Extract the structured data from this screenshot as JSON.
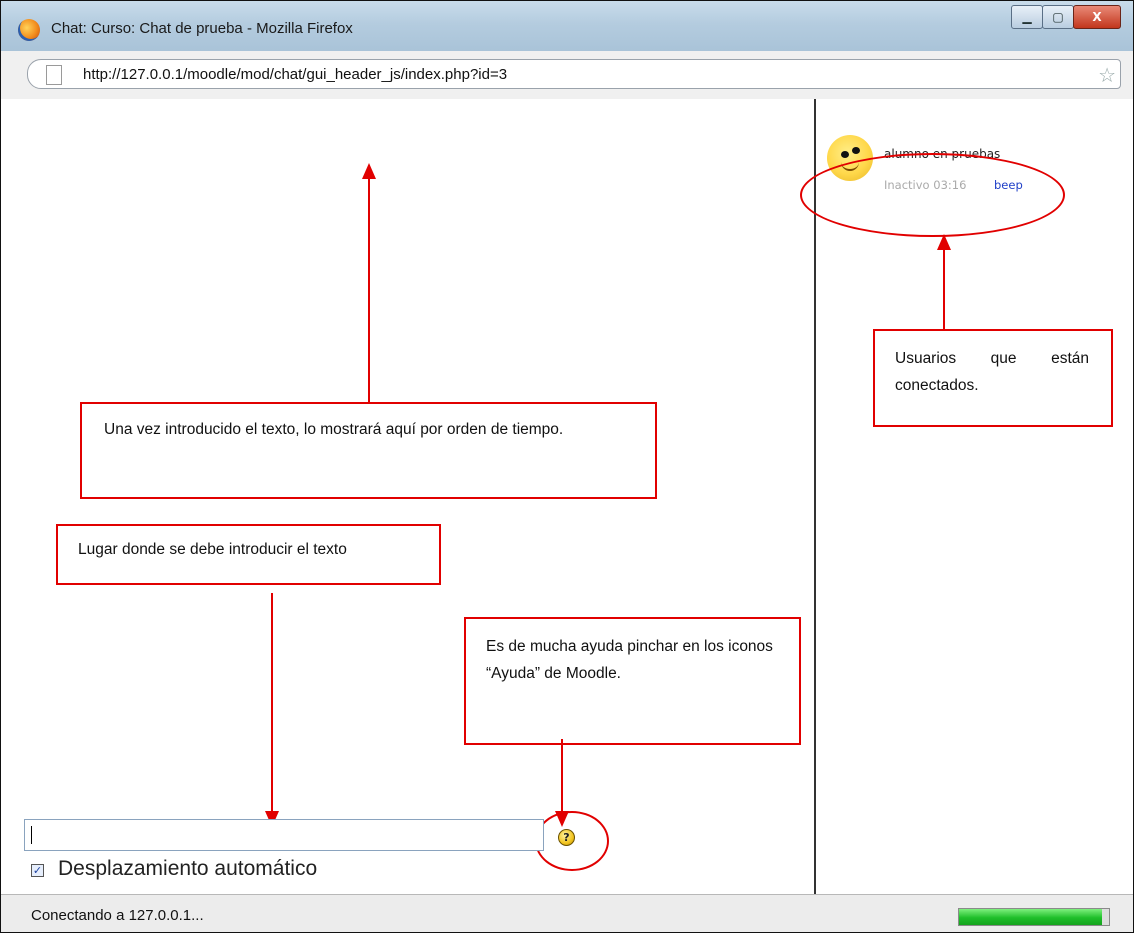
{
  "window": {
    "title": "Chat: Curso: Chat de prueba - Mozilla Firefox",
    "minimize_glyph": "▁",
    "maximize_glyph": "▢",
    "close_glyph": "X"
  },
  "address_bar": {
    "url": "http://127.0.0.1/moodle/mod/chat/gui_header_js/index.php?id=3",
    "bookmark_glyph": "☆"
  },
  "users_panel": {
    "users": [
      {
        "name": "alumno en pruebas",
        "status": "Inactivo 03:16",
        "beep_label": "beep"
      }
    ]
  },
  "annotations": {
    "messages_note": "Una vez introducido el texto, lo mostrará aquí por orden de tiempo.",
    "users_note": "Usuarios que están conectados.",
    "input_note": "Lugar donde se debe introducir el texto",
    "help_note": "Es de mucha ayuda pinchar en los iconos “Ayuda” de Moodle."
  },
  "input_area": {
    "message_value": "",
    "help_glyph": "?",
    "autoscroll_label": "Desplazamiento automático",
    "autoscroll_checked": true
  },
  "status_bar": {
    "text": "Conectando a 127.0.0.1...",
    "progress_percent": 95
  },
  "colors": {
    "annotation_red": "#e10000",
    "link_blue": "#1f3fc7",
    "progress_green": "#1fbf2a"
  }
}
